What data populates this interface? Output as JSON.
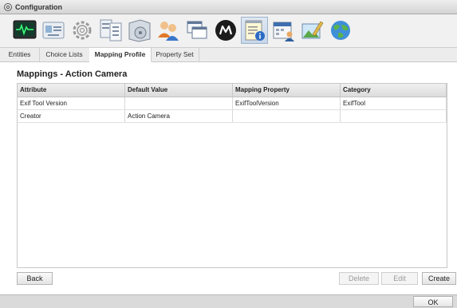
{
  "window": {
    "title": "Configuration"
  },
  "toolbar": {
    "icons": [
      {
        "name": "monitor-icon"
      },
      {
        "name": "id-card-icon"
      },
      {
        "name": "gear-icon"
      },
      {
        "name": "forms-icon"
      },
      {
        "name": "media-archive-icon"
      },
      {
        "name": "users-icon"
      },
      {
        "name": "windows-icon"
      },
      {
        "name": "m-logo-icon"
      },
      {
        "name": "notepad-info-icon",
        "selected": true
      },
      {
        "name": "calendar-user-icon"
      },
      {
        "name": "image-edit-icon"
      },
      {
        "name": "globe-icon"
      }
    ]
  },
  "tabs": [
    {
      "label": "Entities"
    },
    {
      "label": "Choice Lists"
    },
    {
      "label": "Mapping Profile",
      "active": true
    },
    {
      "label": "Property Set"
    }
  ],
  "main": {
    "heading": "Mappings - Action Camera",
    "columns": [
      "Attribute",
      "Default Value",
      "Mapping Property",
      "Category"
    ],
    "rows": [
      [
        "Exif Tool Version",
        "",
        "ExifToolVersion",
        "ExifTool"
      ],
      [
        "Creator",
        "Action Camera",
        "",
        ""
      ]
    ]
  },
  "actions": {
    "back": "Back",
    "delete": "Delete",
    "edit": "Edit",
    "create": "Create"
  },
  "footer": {
    "ok": "OK"
  }
}
